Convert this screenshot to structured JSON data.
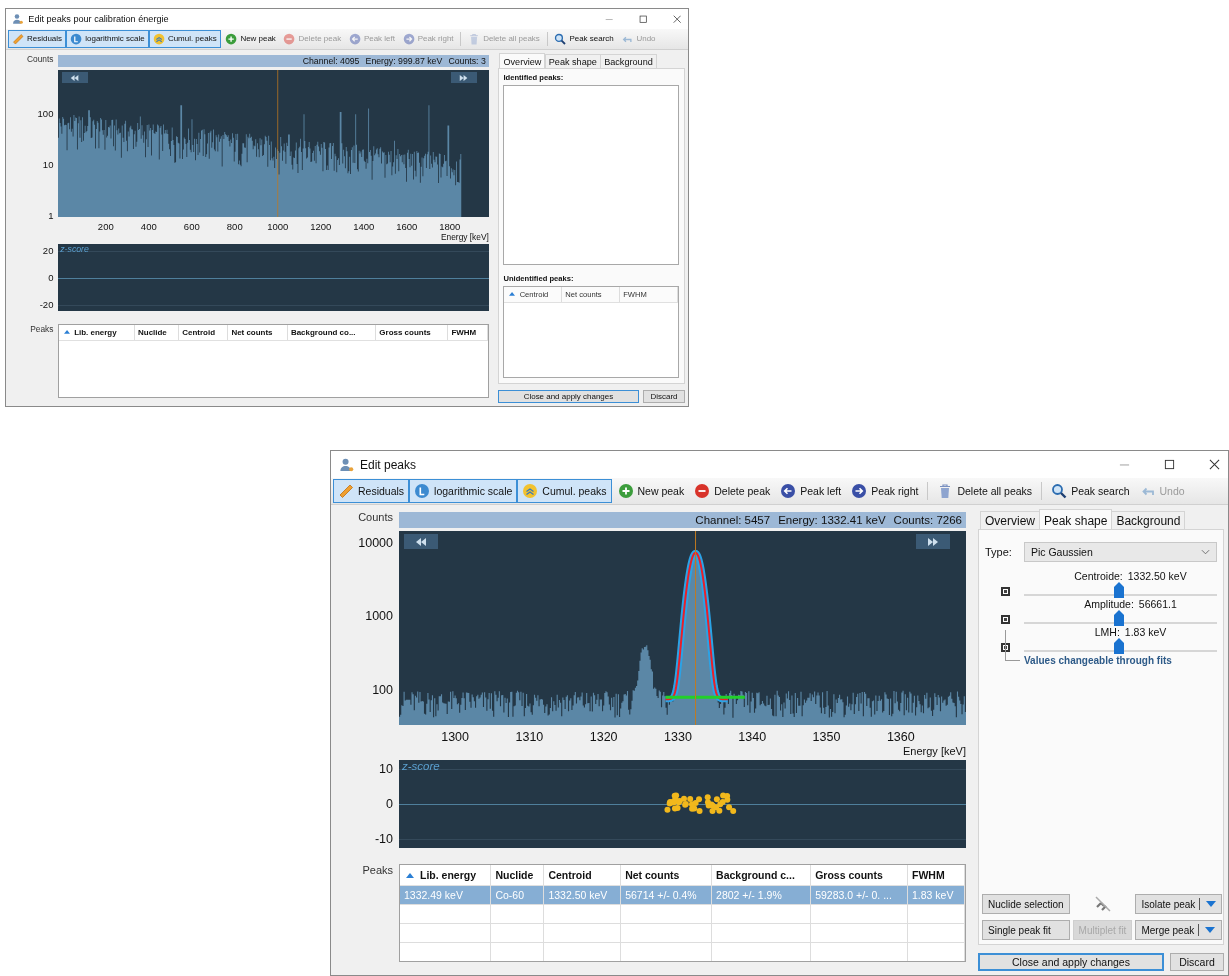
{
  "windows": [
    {
      "title": "Edit peaks pour calibration énergie",
      "toggles": [
        {
          "kind": "ruler",
          "label": "Residuals",
          "selected": true
        },
        {
          "kind": "log",
          "label": "logarithmic scale",
          "selected": true
        },
        {
          "kind": "layers",
          "label": "Cumul. peaks",
          "selected": true
        }
      ],
      "actions": [
        {
          "kind": "add",
          "label": "New peak",
          "disabled": false
        },
        {
          "kind": "remove",
          "label": "Delete peak",
          "disabled": true
        },
        {
          "kind": "left",
          "label": "Peak left",
          "disabled": true
        },
        {
          "kind": "right",
          "label": "Peak right",
          "disabled": true
        },
        {
          "kind": "trash",
          "label": "Delete all peaks",
          "disabled": true
        },
        {
          "kind": "search",
          "label": "Peak search",
          "disabled": false
        },
        {
          "kind": "undo",
          "label": "Undo",
          "disabled": true
        }
      ],
      "spectrum": {
        "kind": "full",
        "ylabel": "Counts",
        "readout": [
          "Channel: 4095",
          "Energy: 999.87 keV",
          "Counts: 3"
        ],
        "yticks": [
          "100",
          "10",
          "1"
        ],
        "xticks": [
          "200",
          "400",
          "600",
          "800",
          "1000",
          "1200",
          "1400",
          "1600",
          "1800"
        ],
        "xlabel": "Energy [keV]"
      },
      "residuals": {
        "label": "z-score",
        "yticks": [
          "20",
          "0",
          "-20"
        ],
        "points": false
      },
      "peaks": {
        "label": "Peaks",
        "columns": [
          {
            "label": "Lib. energy",
            "sorted": true
          },
          {
            "label": "Nuclide",
            "sorted": false
          },
          {
            "label": "Centroid",
            "sorted": false
          },
          {
            "label": "Net counts",
            "sorted": false
          },
          {
            "label": "Background co...",
            "sorted": false
          },
          {
            "label": "Gross counts",
            "sorted": false
          },
          {
            "label": "FWHM",
            "sorted": false
          }
        ]
      },
      "tabs": [
        {
          "label": "Overview",
          "selected": true
        },
        {
          "label": "Peak shape",
          "selected": false
        },
        {
          "label": "Background",
          "selected": false
        }
      ],
      "panel": {
        "kind": "overview",
        "identified_label": "Identified peaks:",
        "unidentified_label": "Unidentified peaks:",
        "columns": [
          {
            "label": "Centroid",
            "sorted": true
          },
          {
            "label": "Net counts",
            "sorted": false
          },
          {
            "label": "FWHM",
            "sorted": false
          }
        ]
      },
      "buttons": [
        {
          "label": "Close and apply changes",
          "default": true
        },
        {
          "label": "Discard",
          "default": false
        }
      ]
    },
    {
      "title": "Edit peaks",
      "toggles": [
        {
          "kind": "ruler",
          "label": "Residuals",
          "selected": true
        },
        {
          "kind": "log",
          "label": "logarithmic scale",
          "selected": true
        },
        {
          "kind": "layers",
          "label": "Cumul. peaks",
          "selected": true
        }
      ],
      "actions": [
        {
          "kind": "add",
          "label": "New peak",
          "disabled": false
        },
        {
          "kind": "remove",
          "label": "Delete peak",
          "disabled": false
        },
        {
          "kind": "left",
          "label": "Peak left",
          "disabled": false
        },
        {
          "kind": "right",
          "label": "Peak right",
          "disabled": false
        },
        {
          "kind": "trash",
          "label": "Delete all peaks",
          "disabled": false
        },
        {
          "kind": "search",
          "label": "Peak search",
          "disabled": false
        },
        {
          "kind": "undo",
          "label": "Undo",
          "disabled": true
        }
      ],
      "spectrum": {
        "kind": "peak",
        "ylabel": "Counts",
        "readout": [
          "Channel: 5457",
          "Energy: 1332.41 keV",
          "Counts: 7266"
        ],
        "yticks": [
          "10000",
          "1000",
          "100"
        ],
        "xticks": [
          "1300",
          "1310",
          "1320",
          "1330",
          "1340",
          "1350",
          "1360"
        ],
        "xlabel": "Energy [keV]"
      },
      "residuals": {
        "label": "z-score",
        "yticks": [
          "10",
          "0",
          "-10"
        ],
        "points": true
      },
      "peaks": {
        "label": "Peaks",
        "columns": [
          {
            "label": "Lib. energy",
            "sorted": true
          },
          {
            "label": "Nuclide",
            "sorted": false
          },
          {
            "label": "Centroid",
            "sorted": false
          },
          {
            "label": "Net counts",
            "sorted": false
          },
          {
            "label": "Background c...",
            "sorted": false
          },
          {
            "label": "Gross counts",
            "sorted": false
          },
          {
            "label": "FWHM",
            "sorted": false
          }
        ],
        "rows": [
          {
            "selected": true,
            "cells": [
              "1332.49 keV",
              "Co-60",
              "1332.50 keV",
              "56714 +/- 0.4%",
              "2802 +/- 1.9%",
              "59283.0 +/- 0. ...",
              "1.83 keV"
            ]
          }
        ]
      },
      "tabs": [
        {
          "label": "Overview",
          "selected": false
        },
        {
          "label": "Peak shape",
          "selected": true
        },
        {
          "label": "Background",
          "selected": false
        }
      ],
      "panel": {
        "kind": "peak_shape",
        "type_label": "Type:",
        "type_value": "Pic Gaussien",
        "sliders": [
          {
            "label": "Centroide:",
            "value": "1332.50 keV",
            "level": 0.49,
            "checked": true
          },
          {
            "label": "Amplitude:",
            "value": "56661.1",
            "level": 0.49,
            "checked": true
          },
          {
            "label": "LMH:",
            "value": "1.83 keV",
            "level": 0.49,
            "checked": true
          }
        ],
        "note": "Values changeable through fits",
        "controls": [
          {
            "kind": "plain",
            "label": "Nuclide selection",
            "disabled": false
          },
          {
            "kind": "icon"
          },
          {
            "kind": "split",
            "label": "Isolate peak",
            "disabled": false
          },
          {
            "kind": "plain",
            "label": "Single peak fit",
            "disabled": false
          },
          {
            "kind": "plain",
            "label": "Multiplet fit",
            "disabled": true
          },
          {
            "kind": "split",
            "label": "Merge peak",
            "disabled": false
          }
        ]
      },
      "buttons": [
        {
          "label": "Close and apply changes",
          "default": true
        },
        {
          "label": "Discard",
          "default": false
        }
      ]
    }
  ]
}
